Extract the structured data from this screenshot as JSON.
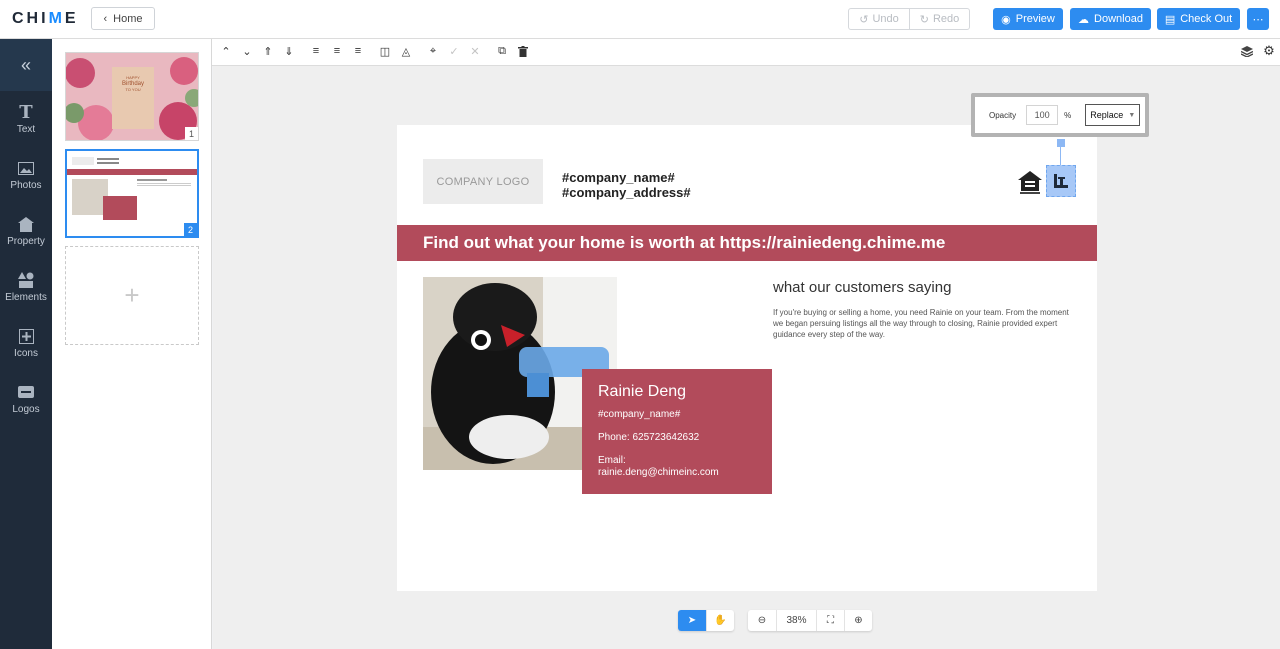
{
  "app": {
    "logo_pre": "CHI",
    "logo_dot": "M",
    "logo_post": "E"
  },
  "topbar": {
    "home_label": "Home",
    "undo_label": "Undo",
    "redo_label": "Redo",
    "preview_label": "Preview",
    "download_label": "Download",
    "checkout_label": "Check Out",
    "more_label": "⋯"
  },
  "leftnav": {
    "collapse": "«",
    "items": [
      {
        "label": "Text",
        "icon": "text-icon"
      },
      {
        "label": "Photos",
        "icon": "photos-icon"
      },
      {
        "label": "Property",
        "icon": "property-icon"
      },
      {
        "label": "Elements",
        "icon": "elements-icon"
      },
      {
        "label": "Icons",
        "icon": "icons-icon"
      },
      {
        "label": "Logos",
        "icon": "logos-icon"
      }
    ]
  },
  "pages": {
    "thumb1": {
      "number": "1",
      "line1": "HAPPY",
      "line2": "Birthday",
      "line3": "TO YOU"
    },
    "thumb2": {
      "number": "2"
    },
    "add": "+"
  },
  "canvas": {
    "company_logo": "COMPANY LOGO",
    "company_name": "#company_name#",
    "company_address": "#company_address#",
    "banner": "Find out what your home is worth at https://rainiedeng.chime.me",
    "agent": {
      "name": "Rainie Deng",
      "company": "#company_name#",
      "phone": "Phone: 625723642632",
      "email_label": "Email:",
      "email": "rainie.deng@chimeinc.com"
    },
    "testimonial_title": "what our customers saying",
    "testimonial_body": "If you're buying or selling a home, you need Rainie on your team. From the moment we began persuing listings all the way through to closing, Rainie provided expert guidance every step of the way."
  },
  "opacity": {
    "label": "Opacity",
    "value": "100",
    "unit": "%",
    "mode": "Replace"
  },
  "zoom": {
    "level": "38%"
  },
  "colors": {
    "accent": "#2d8cf0",
    "brand": "#b24b5b",
    "nav": "#1f2b3a"
  }
}
